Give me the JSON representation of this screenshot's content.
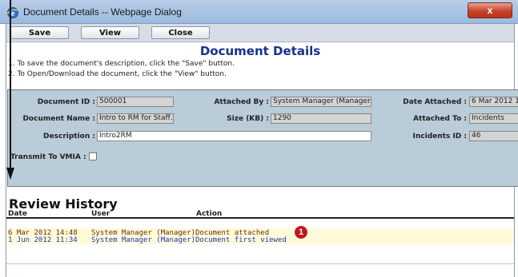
{
  "window": {
    "title": "Document Details -- Webpage Dialog",
    "close_glyph": "x"
  },
  "toolbar": {
    "save_label": "Save",
    "view_label": "View",
    "close_label": "Close"
  },
  "page": {
    "heading": "Document Details",
    "instructions": [
      "1.  To save the document's description, click the \"Save\" button.",
      "2.  To Open/Download the document, click the  \"View\" button."
    ]
  },
  "form": {
    "document_id": {
      "label": "Document ID :",
      "value": "500001"
    },
    "attached_by": {
      "label": "Attached By :",
      "value": "System Manager (Manager)"
    },
    "date_attached": {
      "label": "Date Attached :",
      "value": "6 Mar 2012 1"
    },
    "document_name": {
      "label": "Document Name :",
      "value": "Intro to RM for Staff.pdf"
    },
    "size": {
      "label": "Size (KB) :",
      "value": "1290"
    },
    "attached_to": {
      "label": "Attached To :",
      "value": "Incidents"
    },
    "description": {
      "label": "Description :",
      "value": "Intro2RM"
    },
    "incidents_id": {
      "label": "Incidents ID :",
      "value": "46"
    },
    "transmit": {
      "label": "Transmit To VMIA :",
      "checked": false
    }
  },
  "review_history": {
    "title": "Review History",
    "columns": {
      "date": "Date",
      "user": "User",
      "action": "Action"
    },
    "rows": [
      {
        "date": "6 Mar 2012 14:48",
        "user": "System Manager (Manager)",
        "action": "Document attached",
        "color": "#6b2a10"
      },
      {
        "date": "1 Jun 2012 11:34",
        "user": "System Manager (Manager)",
        "action": "Document first viewed",
        "color": "#1a33c8"
      }
    ]
  },
  "annotation": {
    "marker_number": "1",
    "marker_color": "#c0191a"
  }
}
